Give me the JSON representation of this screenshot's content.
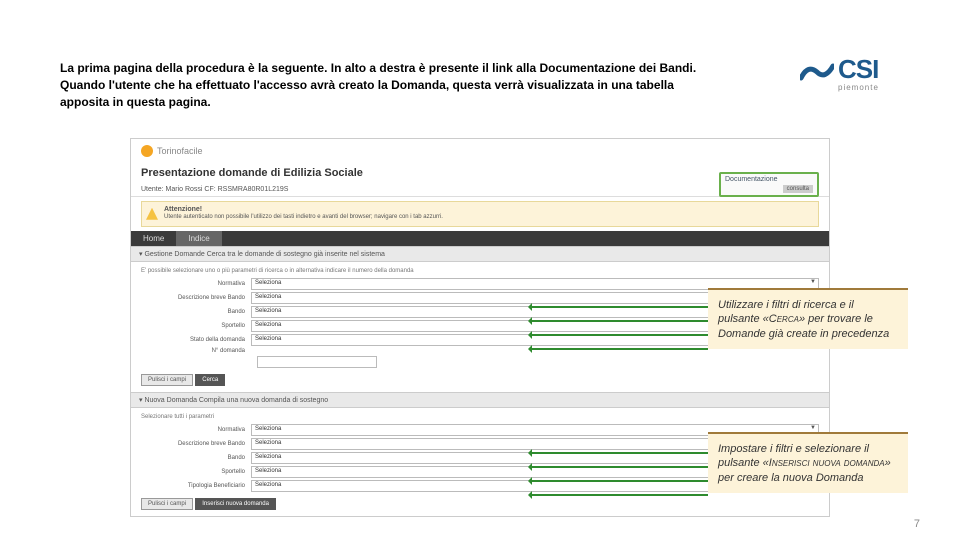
{
  "intro": "La prima pagina della procedura è la seguente. In alto a destra è presente il link alla Documentazione dei Bandi. Quando l'utente che ha effettuato l'accesso avrà creato la Domanda, questa verrà visualizzata in una tabella apposita in questa pagina.",
  "logo": {
    "main": "CSI",
    "sub": "piemonte"
  },
  "tf_brand": "Torinofacile",
  "page_title": "Presentazione domande di Edilizia Sociale",
  "user_line": "Utente: Mario Rossi   CF: RSSMRA80R01L219S",
  "doc_label": "Documentazione",
  "doc_btn": "consulta",
  "warning": {
    "title": "Attenzione!",
    "body": "Utente autenticato non possibile l'utilizzo dei tasti indietro e avanti del browser; navigare con i tab azzurri."
  },
  "tabs": [
    "Home",
    "Indice"
  ],
  "search": {
    "head": "▾ Gestione Domande  Cerca tra le domande di sostegno già inserite nel sistema",
    "hint": "E' possibile selezionare uno o più parametri di ricerca o in alternativa indicare il numero della domanda",
    "labels": [
      "Normativa",
      "Descrizione breve Bando",
      "Bando",
      "Sportello",
      "Stato della domanda"
    ],
    "value": "Seleziona",
    "num_label": "N° domanda",
    "btn_clear": "Pulisci i campi",
    "btn_search": "Cerca"
  },
  "new": {
    "head": "▾ Nuova Domanda  Compila una nuova domanda di sostegno",
    "hint": "Selezionare tutti i parametri",
    "labels": [
      "Normativa",
      "Descrizione breve Bando",
      "Bando",
      "Sportello",
      "Tipologia Beneficiario"
    ],
    "value": "Seleziona",
    "btn_clear": "Pulisci i campi",
    "btn_insert": "Inserisci nuova domanda"
  },
  "callout1": {
    "p1": "Utilizzare i filtri di ricerca e il pulsante «",
    "cap": "Cerca",
    "p2": "» per trovare le Domande già create in precedenza"
  },
  "callout2": {
    "p1": "Impostare i filtri e selezionare il pulsante «",
    "cap": "Inserisci nuova domanda",
    "p2": "» per creare la nuova Domanda"
  },
  "page_num": "7"
}
